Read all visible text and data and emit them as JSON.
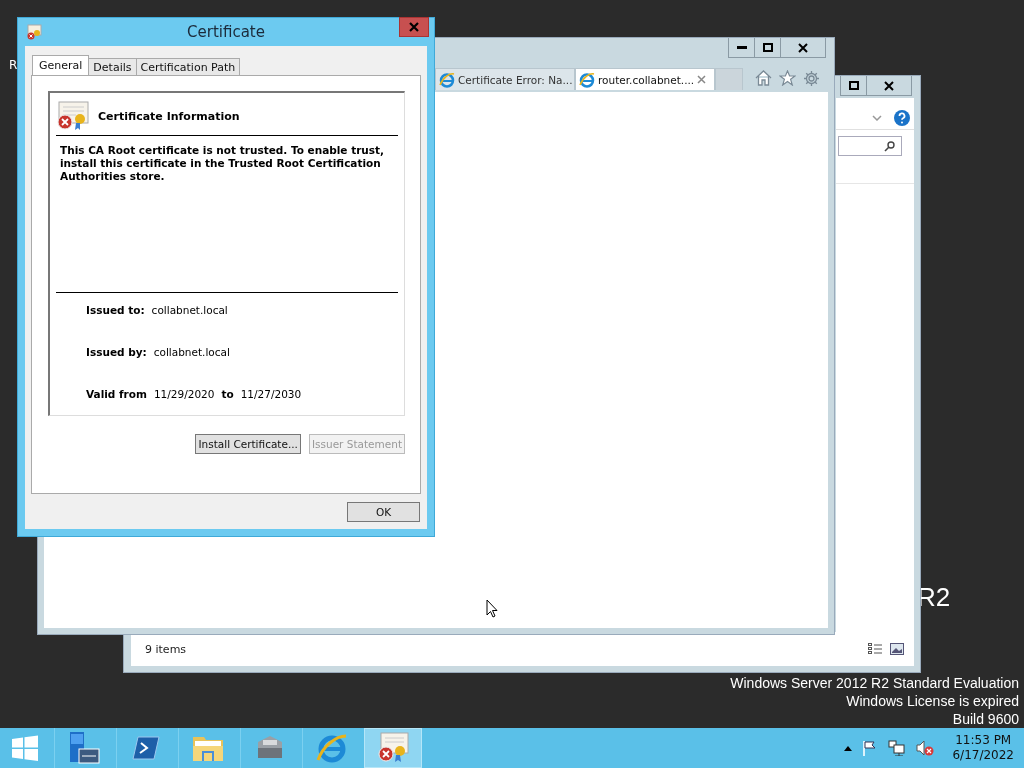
{
  "desktop": {
    "icon_label": "R",
    "branding": "R2",
    "notice": [
      "Windows Server 2012 R2 Standard Evaluation",
      "Windows License is expired",
      "Build 9600"
    ]
  },
  "explorer": {
    "status": "9 items"
  },
  "browser": {
    "tabs": [
      {
        "label": "Certificate Error: Na...",
        "selected": false
      },
      {
        "label": "router.collabnet....",
        "selected": true
      }
    ]
  },
  "dialog": {
    "title": "Certificate",
    "tabs": [
      {
        "label": "General",
        "selected": true
      },
      {
        "label": "Details",
        "selected": false
      },
      {
        "label": "Certification Path",
        "selected": false
      }
    ],
    "heading": "Certificate Information",
    "message": "This CA Root certificate is not trusted. To enable trust, install this certificate in the Trusted Root Certification Authorities store.",
    "fields": [
      {
        "label": "Issued to:",
        "value": "collabnet.local"
      },
      {
        "label": "Issued by:",
        "value": "collabnet.local"
      }
    ],
    "validity": {
      "label": "Valid from",
      "from": "11/29/2020",
      "to_label": "to",
      "to": "11/27/2030"
    },
    "buttons": [
      {
        "label": "Install Certificate...",
        "disabled": false
      },
      {
        "label": "Issuer Statement",
        "disabled": true
      }
    ],
    "ok": "OK"
  },
  "taskbar": {
    "apps": [
      {
        "kind": "server-manager",
        "active": false
      },
      {
        "kind": "powershell",
        "active": false
      },
      {
        "kind": "explorer",
        "active": false
      },
      {
        "kind": "toolbox",
        "active": false
      },
      {
        "kind": "ie",
        "active": false
      },
      {
        "kind": "certificate",
        "active": true
      }
    ],
    "clock": {
      "time": "11:53 PM",
      "date": "6/17/2022"
    }
  }
}
